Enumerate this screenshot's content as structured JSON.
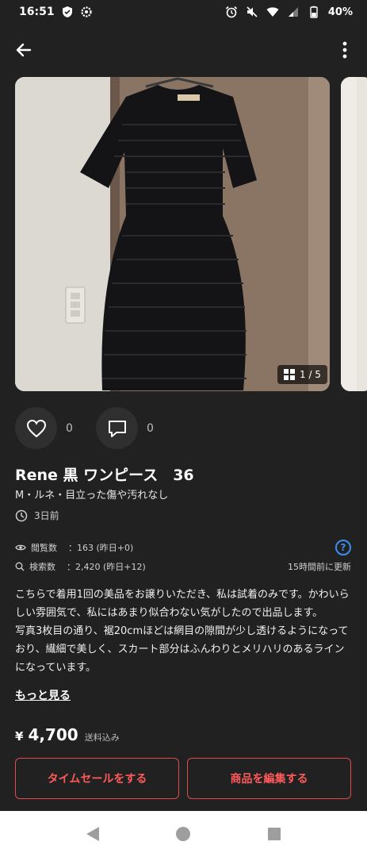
{
  "status_bar": {
    "time": "16:51",
    "battery": "40%",
    "left_icons": [
      "shield-icon",
      "gear-icon"
    ],
    "right_icons": [
      "alarm-icon",
      "mute-icon",
      "wifi-icon",
      "signal-icon",
      "battery-icon"
    ]
  },
  "app_bar": {
    "back_icon": "arrow-left-icon",
    "more_icon": "more-vertical-icon"
  },
  "photo": {
    "counter": "1 / 5"
  },
  "engagement": {
    "likes": "0",
    "comments": "0"
  },
  "item": {
    "title": "Rene 黒 ワンピース　36",
    "subtitle": "M・ルネ・目立った傷や汚れなし",
    "posted": "3日前"
  },
  "stats": {
    "views_label": "閲覧数",
    "views_value": "：163 (昨日+0)",
    "search_label": "検索数",
    "search_value": "：2,420 (昨日+12)",
    "updated": "15時間前に更新",
    "help": "?"
  },
  "description": {
    "paragraphs": [
      "こちらで着用1回の美品をお譲りいただき、私は試着のみです。かわいらしい雰囲気で、私にはあまり似合わない気がしたので出品します。",
      "写真3枚目の通り、裾20cmほどは網目の隙間が少し透けるようになっており、繊細で美しく、スカート部分はふんわりとメリハリのあるラインになっています。"
    ],
    "more_link": "もっと見る"
  },
  "price": {
    "currency": "¥",
    "amount": "4,700",
    "note": "送料込み"
  },
  "buttons": {
    "time_sale": "タイムセールをする",
    "edit": "商品を編集する"
  },
  "colors": {
    "background": "#212121",
    "accent": "#e04a4a",
    "help_blue": "#3d8ef0"
  }
}
